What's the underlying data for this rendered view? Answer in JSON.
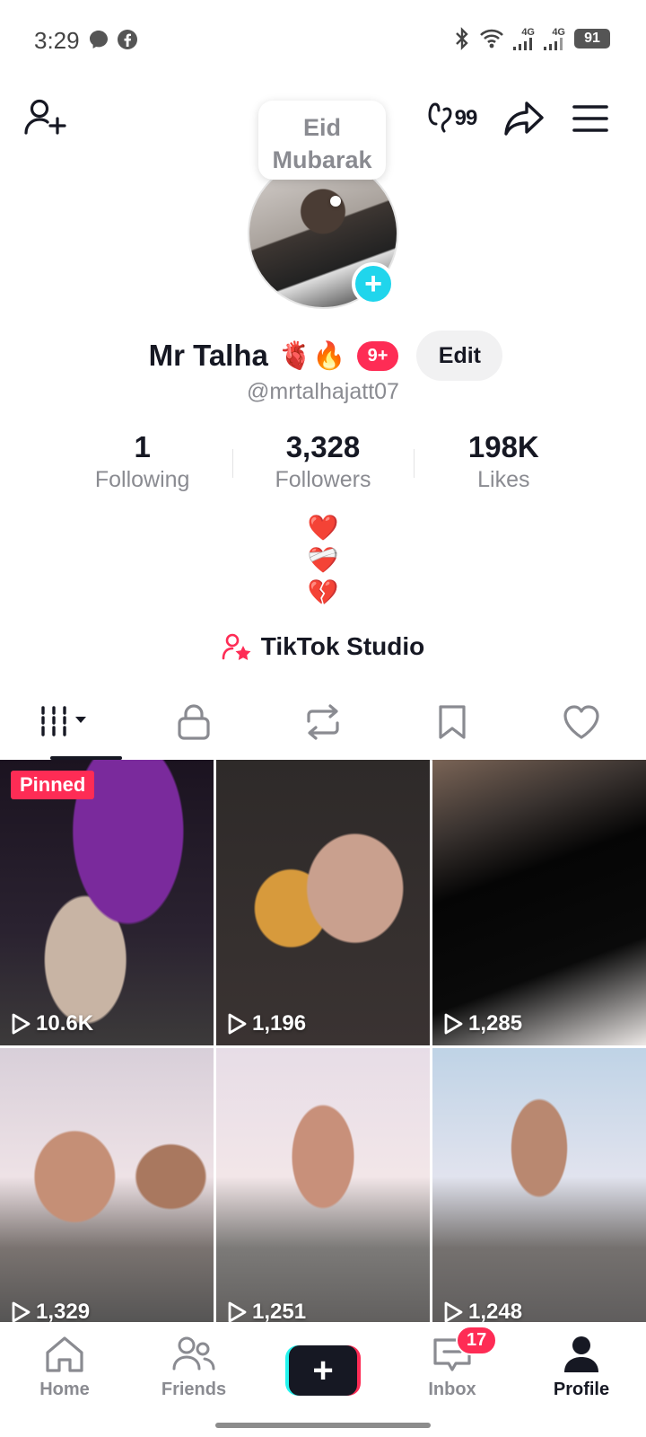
{
  "status_bar": {
    "time": "3:29",
    "left_icons": [
      "messenger-icon",
      "facebook-icon"
    ],
    "right_icons": [
      "bluetooth-icon",
      "wifi-icon",
      "signal-4g-icon",
      "signal-4g-icon"
    ],
    "network_1": "4G",
    "network_2": "4G",
    "battery": "91"
  },
  "top_bar": {
    "left_icon": "add-friend-icon",
    "right_icons": [
      "unique-id-icon",
      "share-icon",
      "menu-icon"
    ],
    "badge_text": "99"
  },
  "profile": {
    "note": "Eid Mubarak",
    "name": "Mr Talha",
    "name_emojis": "🫀🔥",
    "notification_badge": "9+",
    "edit_label": "Edit",
    "handle": "@mrtalhajatt07",
    "stats": [
      {
        "value": "1",
        "label": "Following"
      },
      {
        "value": "3,328",
        "label": "Followers"
      },
      {
        "value": "198K",
        "label": "Likes"
      }
    ],
    "bio_lines": [
      "❤️",
      "❤️‍🩹",
      "💔"
    ],
    "studio_label": "TikTok Studio"
  },
  "tabs": [
    {
      "name": "videos",
      "icon": "grid-icon",
      "active": true
    },
    {
      "name": "private",
      "icon": "lock-icon",
      "active": false
    },
    {
      "name": "reposts",
      "icon": "repost-icon",
      "active": false
    },
    {
      "name": "favorites",
      "icon": "bookmark-icon",
      "active": false
    },
    {
      "name": "liked",
      "icon": "heart-icon",
      "active": false
    }
  ],
  "videos": [
    {
      "views": "10.6K",
      "pinned_label": "Pinned"
    },
    {
      "views": "1,196"
    },
    {
      "views": "1,285"
    },
    {
      "views": "1,329"
    },
    {
      "views": "1,251"
    },
    {
      "views": "1,248"
    }
  ],
  "bottom_nav": {
    "home": "Home",
    "friends": "Friends",
    "inbox": "Inbox",
    "inbox_badge": "17",
    "profile": "Profile"
  },
  "colors": {
    "accent": "#fe2c55",
    "cyan": "#25f4ee",
    "text_primary": "#161823",
    "text_secondary": "#8a8b91"
  }
}
